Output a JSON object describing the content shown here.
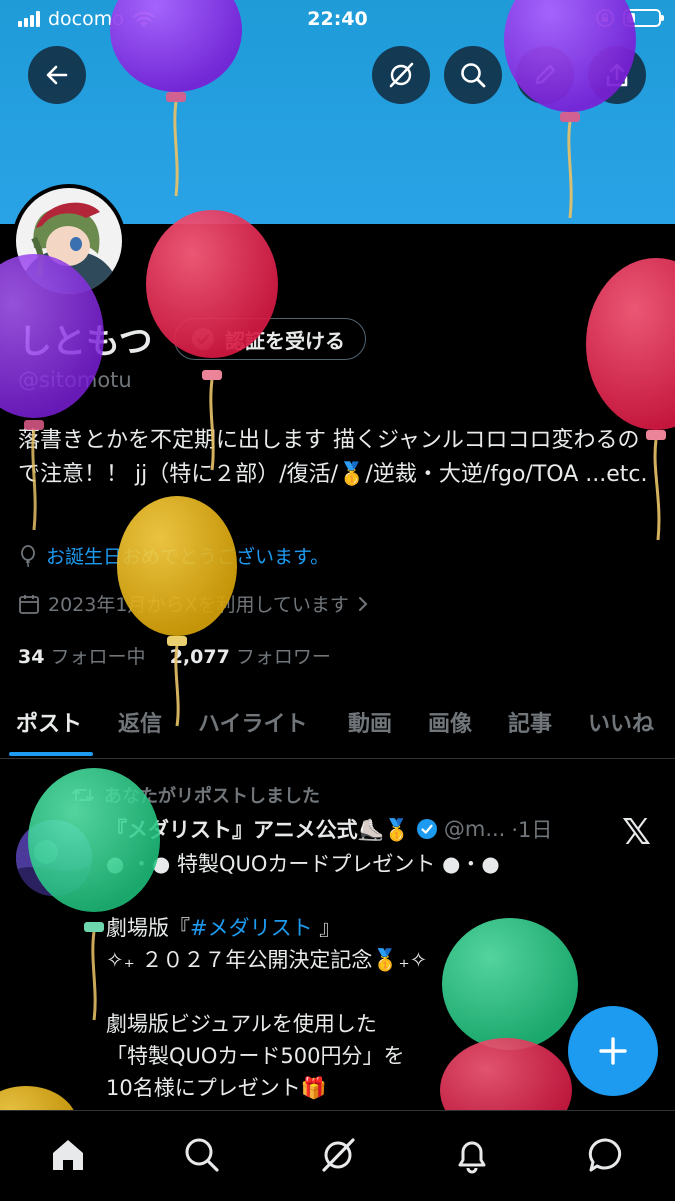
{
  "status_bar": {
    "carrier": "docomo",
    "time": "22:40"
  },
  "header": {
    "buttons": [
      "back-icon",
      "grok-icon",
      "search-icon",
      "edit-icon",
      "share-icon"
    ]
  },
  "profile": {
    "display_name": "しともつ",
    "verify_button_label": "認証を受ける",
    "handle": "@sitomotu",
    "bio": "落書きとかを不定期に出します 描くジャンルコロコロ変わるので注意！！ jj（特に２部）/復活/🥇/逆裁・大逆/fgo/TOA ...etc.",
    "birthday_text": "お誕生日おめでとうございます。",
    "joined_text": "2023年1月からXを利用しています",
    "following_count": "34",
    "following_label": "フォロー中",
    "followers_count": "2,077",
    "followers_label": "フォロワー"
  },
  "tabs": [
    {
      "label": "ポスト",
      "active": true
    },
    {
      "label": "返信",
      "active": false
    },
    {
      "label": "ハイライト",
      "active": false
    },
    {
      "label": "動画",
      "active": false
    },
    {
      "label": "画像",
      "active": false
    },
    {
      "label": "記事",
      "active": false
    },
    {
      "label": "いいね",
      "active": false
    }
  ],
  "post": {
    "repost_label": "あなたがリポストしました",
    "author_name": "『メダリスト』アニメ公式⛸️🥇",
    "author_handle": "@m...",
    "time": "·1日",
    "line1": "● ・● 特製QUOカードプレゼント ●・●",
    "line3_prefix": "劇場版『",
    "hashtag": "#メダリスト",
    "line3_suffix": " 』",
    "line4": "✧₊ ２０２７年公開決定記念🥇₊✧",
    "line6": "劇場版ビジュアルを使用した",
    "line7": "「特製QUOカード500円分」を",
    "line8": "10名様にプレゼント🎁"
  },
  "bottom_nav": [
    "home-icon",
    "search-icon",
    "grok-icon",
    "notifications-icon",
    "messages-icon"
  ],
  "colors": {
    "accent": "#1d9bf0",
    "banner": "#2aa3e6",
    "background": "#000000",
    "secondary_text": "#71767b",
    "balloon_purple": "#8a2be2",
    "balloon_red": "#e0264f",
    "balloon_yellow": "#e2b511",
    "balloon_green": "#2ecf8c"
  }
}
